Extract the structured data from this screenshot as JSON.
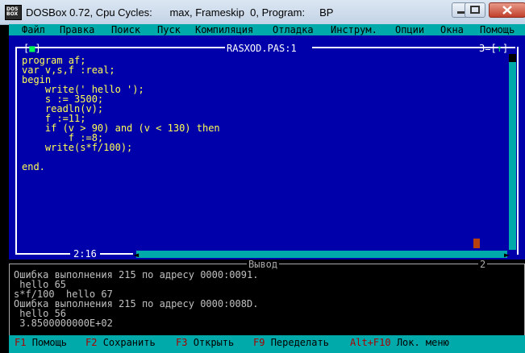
{
  "window": {
    "title": "DOSBox 0.72, Cpu Cycles:      max, Frameskip  0, Program:     BP",
    "icon_text": "DOS\nBOX"
  },
  "menu": [
    {
      "name": "menu-file",
      "label": "Файл"
    },
    {
      "name": "menu-edit",
      "label": "Правка"
    },
    {
      "name": "menu-search",
      "label": "Поиск"
    },
    {
      "name": "menu-run",
      "label": "Пуск"
    },
    {
      "name": "menu-compile",
      "label": "Компиляция"
    },
    {
      "name": "menu-debug",
      "label": "Отладка"
    },
    {
      "name": "menu-tools",
      "label": "Инструм."
    },
    {
      "name": "menu-options",
      "label": "Опции"
    },
    {
      "name": "menu-window",
      "label": "Окна"
    },
    {
      "name": "menu-help",
      "label": "Помощь"
    }
  ],
  "editor": {
    "title": "RASXOD.PAS:1",
    "window_number": "3",
    "close_box": "[■]",
    "zoom_box": "[↑]",
    "cursor_position": "2:16",
    "code": [
      "program af;",
      "var v,s,f :real;",
      "begin",
      "    write(' hello ');",
      "    s := 3500;",
      "    readln(v);",
      "    f :=11;",
      "    if (v > 90) and (v < 130) then",
      "        f :=8;",
      "    write(s*f/100);",
      "",
      "end."
    ]
  },
  "output": {
    "title": "Вывод",
    "window_number": "2",
    "lines": [
      "Ошибка выполнения 215 по адресу 0000:0091.",
      " hello 65",
      "s*f/100  hello 67",
      "Ошибка выполнения 215 по адресу 0000:008D.",
      " hello 56",
      " 3.8500000000E+02"
    ]
  },
  "statusbar": [
    {
      "name": "status-help",
      "key": "F1",
      "label": "Помощь"
    },
    {
      "name": "status-save",
      "key": "F2",
      "label": "Сохранить"
    },
    {
      "name": "status-open",
      "key": "F3",
      "label": "Открыть"
    },
    {
      "name": "status-make",
      "key": "F9",
      "label": "Переделать"
    },
    {
      "name": "status-local-menu",
      "key": "Alt+F10",
      "label": "Лок. меню"
    }
  ],
  "colors": {
    "editor_bg": "#0000aa",
    "menu_bg": "#00aaaa",
    "code_text": "#ffff55",
    "hotkey": "#aa0000"
  }
}
